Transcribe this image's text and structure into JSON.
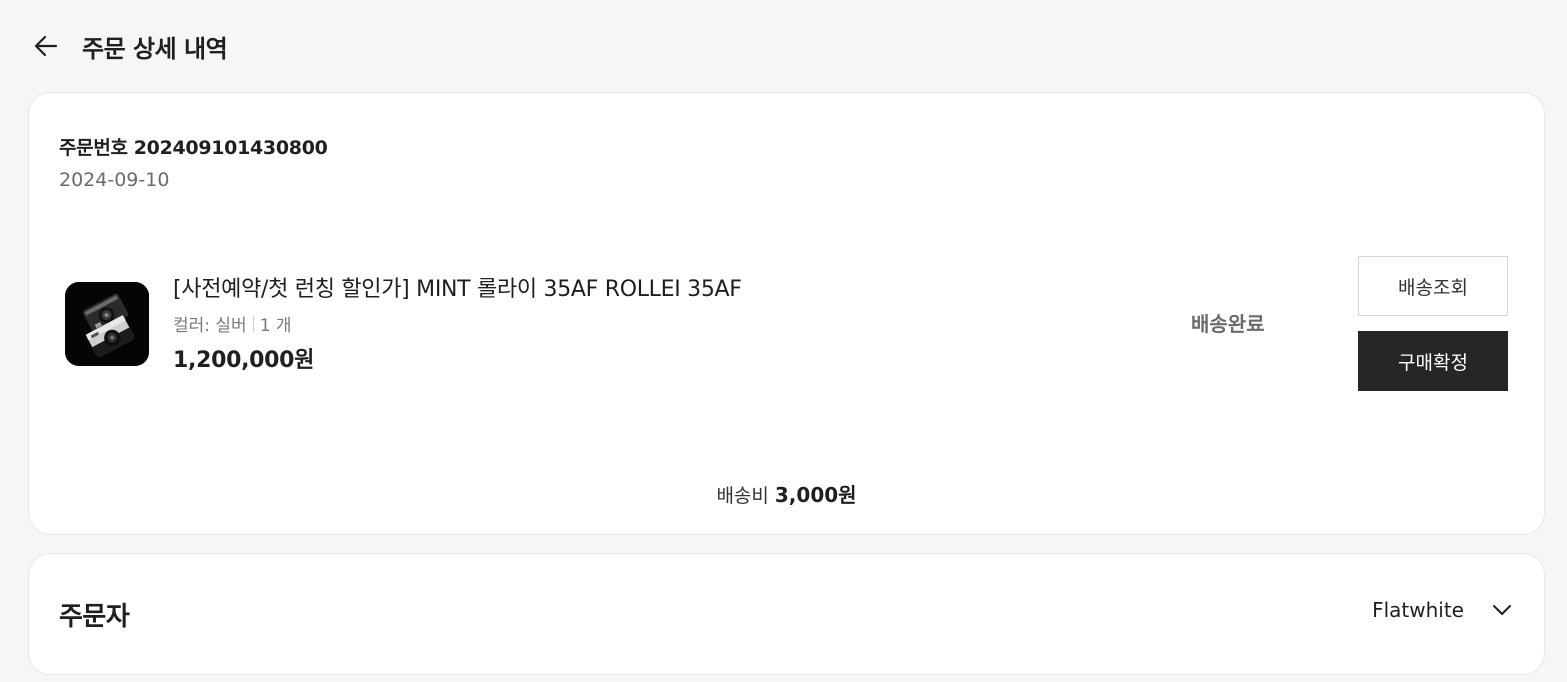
{
  "header": {
    "title": "주문 상세 내역",
    "back_icon": "arrow-left-icon"
  },
  "order": {
    "number_label": "주문번호",
    "number": "202409101430800",
    "date": "2024-09-10",
    "product": {
      "name": "[사전예약/첫 런칭 할인가] MINT 롤라이 35AF ROLLEI 35AF",
      "option": "컬러: 실버",
      "quantity": "1 개",
      "price": "1,200,000원"
    },
    "status": "배송완료",
    "buttons": {
      "track": "배송조회",
      "confirm": "구매확정"
    },
    "shipping": {
      "label": "배송비",
      "fee": "3,000원"
    }
  },
  "orderer": {
    "title": "주문자",
    "name": "Flatwhite",
    "expand_icon": "chevron-down-icon"
  },
  "colors": {
    "background": "#f5f6f8",
    "card": "#ffffff",
    "primary_button": "#262626",
    "muted_text": "#6b6b6b"
  }
}
